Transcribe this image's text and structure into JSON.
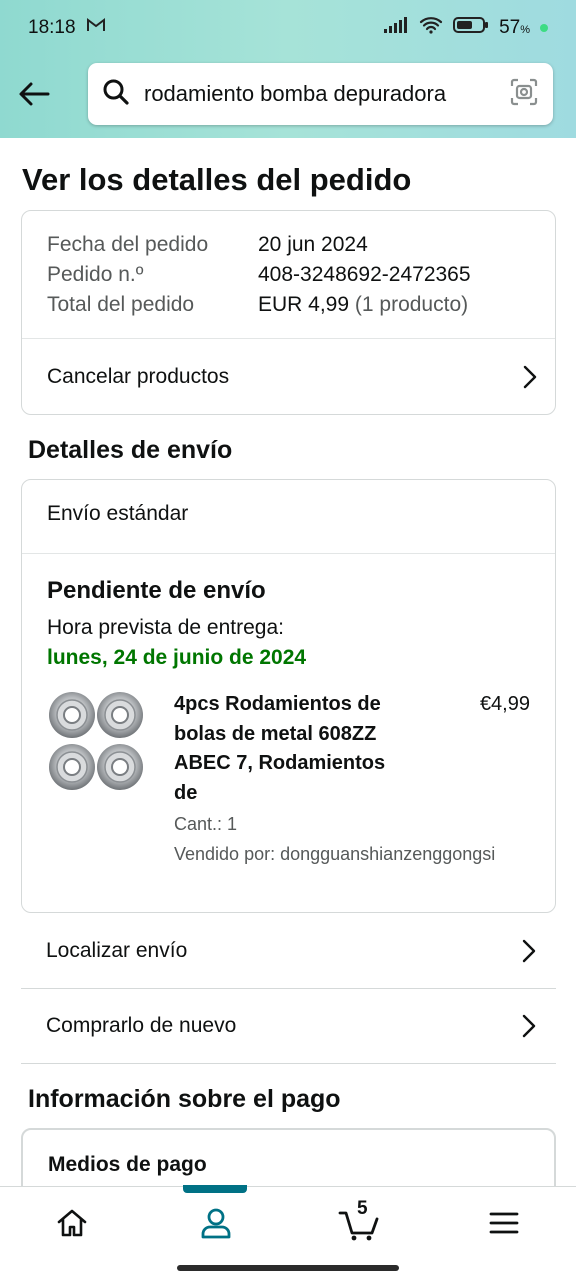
{
  "status": {
    "time": "18:18",
    "battery": "57"
  },
  "search": {
    "query": "rodamiento bomba depuradora"
  },
  "page_title": "Ver los detalles del pedido",
  "summary": {
    "date_label": "Fecha del pedido",
    "date_value": "20 jun 2024",
    "order_label": "Pedido n.º",
    "order_value": "408-3248692-2472365",
    "total_label": "Total del pedido",
    "total_value": "EUR 4,99",
    "total_qty": "(1 producto)",
    "cancel_label": "Cancelar productos"
  },
  "shipping": {
    "heading": "Detalles de envío",
    "method": "Envío estándar",
    "status": "Pendiente de envío",
    "eta_label": "Hora prevista de entrega:",
    "eta_date": "lunes, 24 de junio de 2024",
    "item": {
      "title": "4pcs Rodamientos de bolas de metal 608ZZ ABEC 7, Rodamientos de",
      "price": "€4,99",
      "qty": "Cant.: 1",
      "seller": "Vendido por: dongguanshianzenggongsi"
    },
    "track_label": "Localizar envío",
    "buy_again_label": "Comprarlo de nuevo"
  },
  "payment": {
    "heading": "Información sobre el pago",
    "methods_label": "Medios de pago"
  },
  "nav": {
    "cart_count": "5"
  },
  "colors": {
    "accent": "#007185",
    "green": "#007600"
  }
}
